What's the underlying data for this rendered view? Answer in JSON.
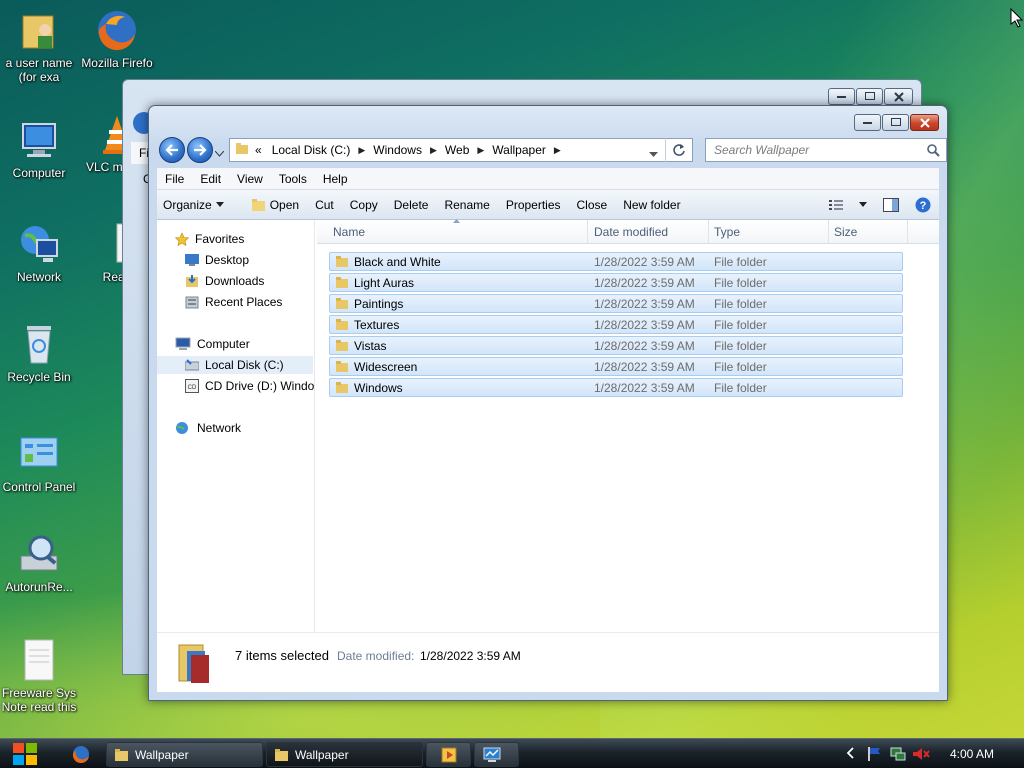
{
  "desktop": {
    "icons": [
      {
        "label": "a user name (for exa",
        "icon": "user-folder-icon"
      },
      {
        "label": "Mozilla Firefo",
        "icon": "firefox-icon"
      },
      {
        "label": "Computer",
        "icon": "computer-icon"
      },
      {
        "label": "VLC m play",
        "icon": "vlc-icon"
      },
      {
        "label": "Network",
        "icon": "network-icon"
      },
      {
        "label": "Read",
        "icon": "document-icon"
      },
      {
        "label": "Recycle Bin",
        "icon": "recycle-bin-icon"
      },
      {
        "label": "Control Panel",
        "icon": "control-panel-icon"
      },
      {
        "label": "AutorunRe...",
        "icon": "autorun-icon"
      },
      {
        "label": "Freeware Sys Note read this",
        "icon": "text-file-icon"
      }
    ]
  },
  "background_window": {
    "address_fragment": "Fi",
    "side_fragment": "C"
  },
  "window": {
    "address_path": [
      "Local Disk (C:)",
      "Windows",
      "Web",
      "Wallpaper"
    ],
    "address_prefix": "«",
    "search_placeholder": "Search Wallpaper",
    "menu": [
      "File",
      "Edit",
      "View",
      "Tools",
      "Help"
    ],
    "toolbar": {
      "organize": "Organize",
      "open": "Open",
      "cut": "Cut",
      "copy": "Copy",
      "delete": "Delete",
      "rename": "Rename",
      "properties": "Properties",
      "close": "Close",
      "new_folder": "New folder"
    },
    "nav": {
      "favorites": "Favorites",
      "desktop": "Desktop",
      "downloads": "Downloads",
      "recent": "Recent Places",
      "computer": "Computer",
      "local_disk": "Local Disk (C:)",
      "cd_drive": "CD Drive (D:) Windo",
      "network": "Network"
    },
    "columns": {
      "name": "Name",
      "date": "Date modified",
      "type": "Type",
      "size": "Size"
    },
    "files": [
      {
        "name": "Black and White",
        "date": "1/28/2022 3:59 AM",
        "type": "File folder"
      },
      {
        "name": "Light Auras",
        "date": "1/28/2022 3:59 AM",
        "type": "File folder"
      },
      {
        "name": "Paintings",
        "date": "1/28/2022 3:59 AM",
        "type": "File folder"
      },
      {
        "name": "Textures",
        "date": "1/28/2022 3:59 AM",
        "type": "File folder"
      },
      {
        "name": "Vistas",
        "date": "1/28/2022 3:59 AM",
        "type": "File folder"
      },
      {
        "name": "Widescreen",
        "date": "1/28/2022 3:59 AM",
        "type": "File folder"
      },
      {
        "name": "Windows",
        "date": "1/28/2022 3:59 AM",
        "type": "File folder"
      }
    ],
    "details": {
      "selected": "7 items selected",
      "date_label": "Date modified:",
      "date_value": "1/28/2022 3:59 AM"
    }
  },
  "taskbar": {
    "buttons": [
      "Wallpaper",
      "Wallpaper"
    ],
    "clock": "4:00 AM"
  },
  "colors": {
    "accent": "#2d70c9",
    "selection": "#d2e5f9"
  }
}
